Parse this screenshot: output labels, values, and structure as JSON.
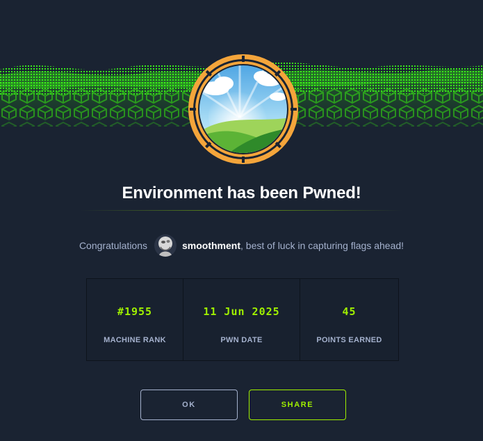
{
  "title": "Environment has been Pwned!",
  "congrats": {
    "prefix": "Congratulations",
    "username": "smoothment",
    "suffix": ", best of luck in capturing flags ahead!"
  },
  "stats": [
    {
      "value": "#1955",
      "label": "MACHINE RANK"
    },
    {
      "value": "11 Jun 2025",
      "label": "PWN DATE"
    },
    {
      "value": "45",
      "label": "POINTS EARNED"
    }
  ],
  "buttons": {
    "ok": "OK",
    "share": "SHARE"
  },
  "colors": {
    "background": "#1a2332",
    "accent_green": "#9fef00",
    "muted_text": "#a4b1cd",
    "badge_ring": "#f4a53b"
  },
  "icons": {
    "badge": "machine-landscape-badge-icon",
    "avatar": "user-avatar-icon",
    "banner": "green-cube-wave-banner"
  }
}
